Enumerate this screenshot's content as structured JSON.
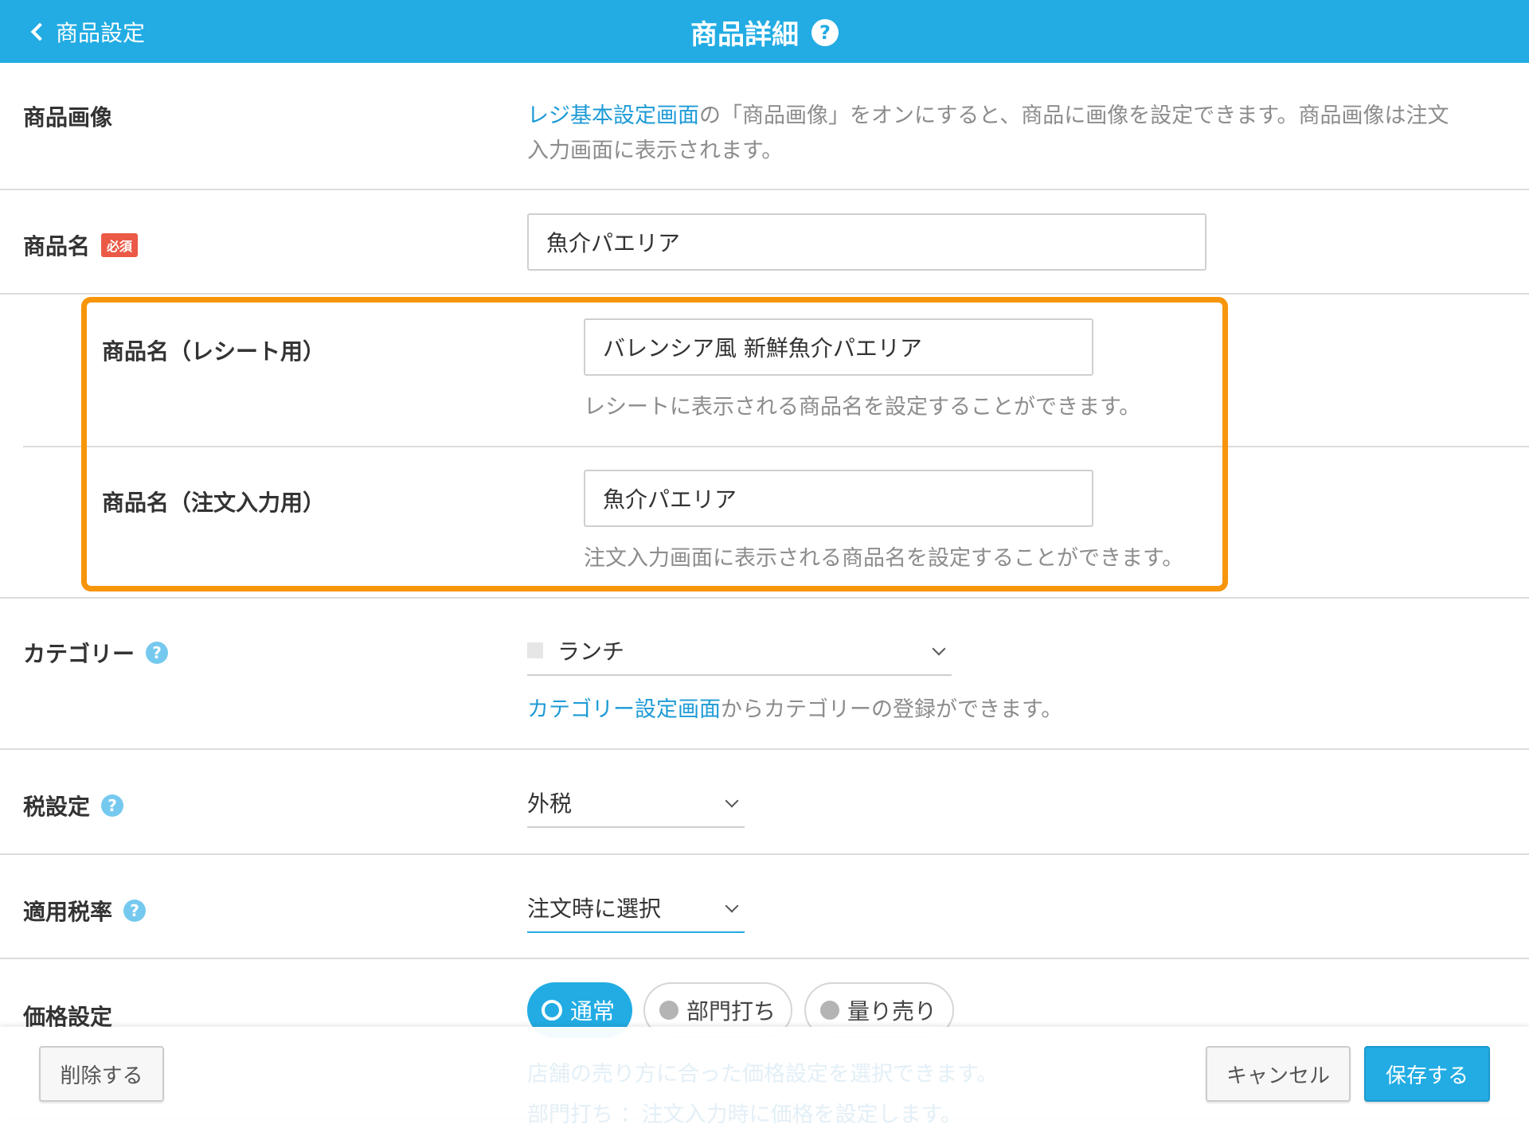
{
  "header": {
    "back_label": "商品設定",
    "title": "商品詳細",
    "help_glyph": "?"
  },
  "product_image": {
    "label": "商品画像",
    "desc_link": "レジ基本設定画面",
    "desc_line1": "の「商品画像」をオンにすると、商品に画像を設定できます。商品画像は注文",
    "desc_line2": "入力画面に表示されます。"
  },
  "product_name": {
    "label": "商品名",
    "required_badge": "必須",
    "value": "魚介パエリア"
  },
  "receipt_name": {
    "label": "商品名（レシート用）",
    "value": "バレンシア風 新鮮魚介パエリア",
    "hint": "レシートに表示される商品名を設定することができます。"
  },
  "order_name": {
    "label": "商品名（注文入力用）",
    "value": "魚介パエリア",
    "hint": "注文入力画面に表示される商品名を設定することができます。"
  },
  "category": {
    "label": "カテゴリー",
    "value": "ランチ",
    "desc_link": "カテゴリー設定画面",
    "desc_rest": "からカテゴリーの登録ができます。"
  },
  "tax": {
    "label": "税設定",
    "value": "外税"
  },
  "tax_rate": {
    "label": "適用税率",
    "value": "注文時に選択"
  },
  "price": {
    "label": "価格設定",
    "options": [
      "通常",
      "部門打ち",
      "量り売り"
    ],
    "selected": "通常",
    "faded_line1": "店舗の売り方に合った価格設定を選択できます。",
    "faded_line2": "部門打ち ：注文入力時に価格を設定します。"
  },
  "footer": {
    "delete": "削除する",
    "cancel": "キャンセル",
    "save": "保存する"
  },
  "colors": {
    "brand": "#22ace3",
    "highlight": "#f7950b",
    "required": "#ea5a47"
  }
}
